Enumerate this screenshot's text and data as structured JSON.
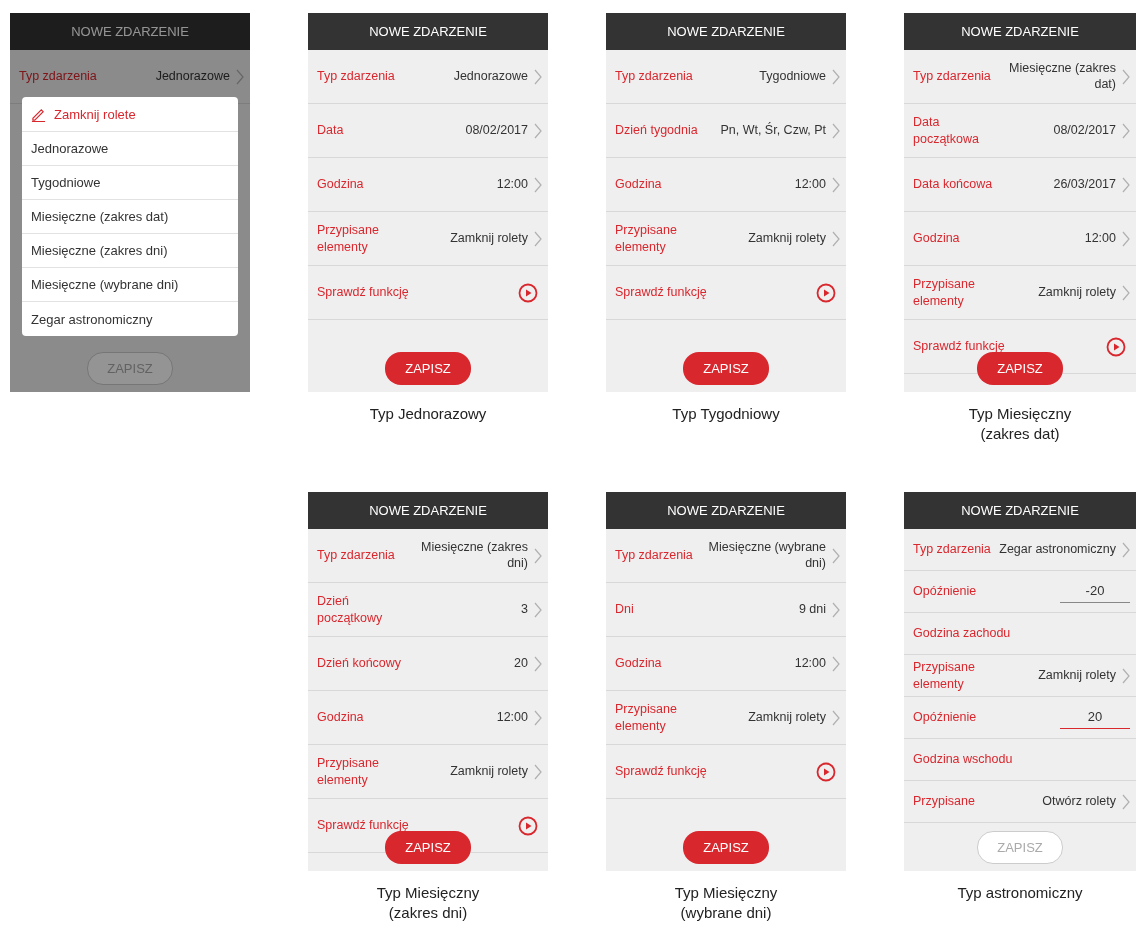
{
  "rows": [
    {
      "screens": [
        {
          "title": "NOWE ZDARZENIE",
          "dimmed": true,
          "rows": [
            {
              "kind": "nav",
              "label": "Typ zdarzenia",
              "value": "Jednorazowe"
            }
          ],
          "menu": {
            "title": "Zamknij rolete",
            "items": [
              "Jednorazowe",
              "Tygodniowe",
              "Miesięczne (zakres dat)",
              "Miesięczne (zakres dni)",
              "Miesięczne (wybrane dni)",
              "Zegar astronomiczny"
            ]
          },
          "save": {
            "label": "ZAPISZ",
            "disabled": true
          }
        },
        {
          "title": "NOWE ZDARZENIE",
          "dimmed": false,
          "rows": [
            {
              "kind": "nav",
              "label": "Typ zdarzenia",
              "value": "Jednorazowe"
            },
            {
              "kind": "nav",
              "label": "Data",
              "value": "08/02/2017"
            },
            {
              "kind": "nav",
              "label": "Godzina",
              "value": "12:00"
            },
            {
              "kind": "nav",
              "label": "Przypisane elementy",
              "value": "Zamknij rolety"
            },
            {
              "kind": "test",
              "label": "Sprawdź funkcję"
            }
          ],
          "save": {
            "label": "ZAPISZ",
            "disabled": false
          },
          "caption": "Typ Jednorazowy"
        },
        {
          "title": "NOWE ZDARZENIE",
          "dimmed": false,
          "rows": [
            {
              "kind": "nav",
              "label": "Typ zdarzenia",
              "value": "Tygodniowe"
            },
            {
              "kind": "nav",
              "label": "Dzień tygodnia",
              "value": "Pn, Wt, Śr, Czw, Pt"
            },
            {
              "kind": "nav",
              "label": "Godzina",
              "value": "12:00"
            },
            {
              "kind": "nav",
              "label": "Przypisane elementy",
              "value": "Zamknij rolety"
            },
            {
              "kind": "test",
              "label": "Sprawdź funkcję"
            }
          ],
          "save": {
            "label": "ZAPISZ",
            "disabled": false
          },
          "caption": "Typ Tygodniowy"
        },
        {
          "title": "NOWE ZDARZENIE",
          "dimmed": false,
          "rows": [
            {
              "kind": "nav",
              "label": "Typ zdarzenia",
              "value": "Miesięczne (zakres dat)"
            },
            {
              "kind": "nav",
              "label": "Data początkowa",
              "value": "08/02/2017"
            },
            {
              "kind": "nav",
              "label": "Data końcowa",
              "value": "26/03/2017"
            },
            {
              "kind": "nav",
              "label": "Godzina",
              "value": "12:00"
            },
            {
              "kind": "nav",
              "label": "Przypisane elementy",
              "value": "Zamknij rolety"
            },
            {
              "kind": "test",
              "label": "Sprawdź funkcję"
            }
          ],
          "save": {
            "label": "ZAPISZ",
            "disabled": false
          },
          "caption": "Typ Miesięczny (zakres dat)"
        }
      ]
    },
    {
      "screens": [
        {
          "title": "NOWE ZDARZENIE",
          "dimmed": false,
          "rows": [
            {
              "kind": "nav",
              "label": "Typ zdarzenia",
              "value": "Miesięczne (zakres dni)"
            },
            {
              "kind": "nav",
              "label": "Dzień początkowy",
              "value": "3"
            },
            {
              "kind": "nav",
              "label": "Dzień końcowy",
              "value": "20"
            },
            {
              "kind": "nav",
              "label": "Godzina",
              "value": "12:00"
            },
            {
              "kind": "nav",
              "label": "Przypisane elementy",
              "value": "Zamknij rolety"
            },
            {
              "kind": "test",
              "label": "Sprawdź funkcję"
            }
          ],
          "save": {
            "label": "ZAPISZ",
            "disabled": false
          },
          "caption": "Typ Miesięczny (zakres dni)"
        },
        {
          "title": "NOWE ZDARZENIE",
          "dimmed": false,
          "rows": [
            {
              "kind": "nav",
              "label": "Typ zdarzenia",
              "value": "Miesięczne (wybrane dni)"
            },
            {
              "kind": "nav",
              "label": "Dni",
              "value": "9 dni"
            },
            {
              "kind": "nav",
              "label": "Godzina",
              "value": "12:00"
            },
            {
              "kind": "nav",
              "label": "Przypisane elementy",
              "value": "Zamknij rolety"
            },
            {
              "kind": "test",
              "label": "Sprawdź funkcję"
            }
          ],
          "save": {
            "label": "ZAPISZ",
            "disabled": false
          },
          "caption": "Typ Miesięczny (wybrane dni)"
        },
        {
          "title": "NOWE ZDARZENIE",
          "dimmed": false,
          "rows": [
            {
              "kind": "nav",
              "label": "Typ zdarzenia",
              "value": "Zegar astronomiczny"
            },
            {
              "kind": "input",
              "label": "Opóźnienie",
              "value": "-20",
              "focused": false
            },
            {
              "kind": "plain",
              "label": "Godzina zachodu"
            },
            {
              "kind": "nav",
              "label": "Przypisane elementy",
              "value": "Zamknij rolety"
            },
            {
              "kind": "input",
              "label": "Opóźnienie",
              "value": "20",
              "focused": true
            },
            {
              "kind": "plain",
              "label": "Godzina wschodu"
            },
            {
              "kind": "nav",
              "label": "Przypisane",
              "value": "Otwórz rolety"
            }
          ],
          "save": {
            "label": "ZAPISZ",
            "disabled": true
          },
          "caption": "Typ astronomiczny"
        }
      ]
    }
  ]
}
